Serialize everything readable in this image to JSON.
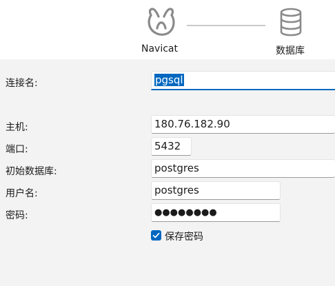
{
  "steps": {
    "navicat_label": "Navicat",
    "database_label": "数据库",
    "navicat_icon": "navicat-logo-icon",
    "database_icon": "database-icon"
  },
  "form": {
    "connection_name": {
      "label": "连接名:",
      "value": "pgsql"
    },
    "host": {
      "label": "主机:",
      "value": "180.76.182.90"
    },
    "port": {
      "label": "端口:",
      "value": "5432"
    },
    "initial_database": {
      "label": "初始数据库:",
      "value": "postgres"
    },
    "username": {
      "label": "用户名:",
      "value": "postgres"
    },
    "password": {
      "label": "密码:",
      "value": "●●●●●●●●"
    },
    "save_password": {
      "label": "保存密码",
      "checked": true
    }
  },
  "colors": {
    "accent": "#0067c0",
    "background": "#f3f3f3",
    "header_background": "#ffffff"
  }
}
